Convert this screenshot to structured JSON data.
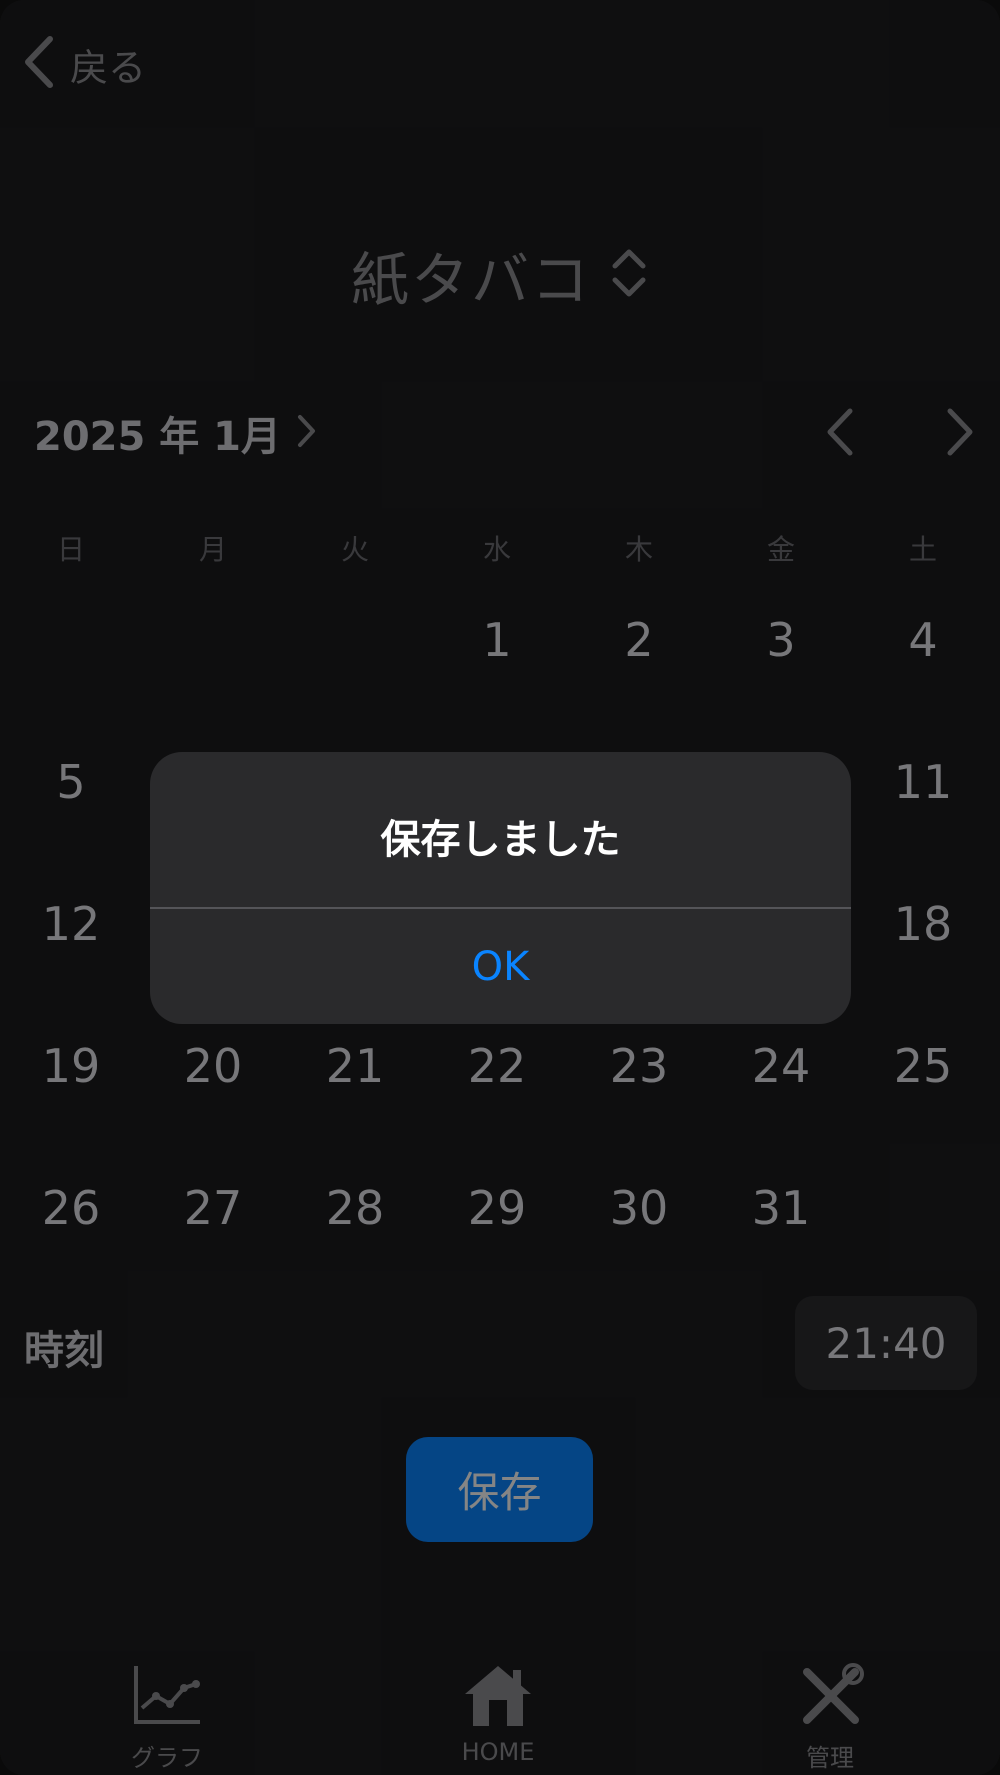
{
  "header": {
    "back_label": "戻る"
  },
  "category": {
    "label": "紙タバコ"
  },
  "calendar": {
    "month_label": "2025 年 1月",
    "weekdays": [
      "日",
      "月",
      "火",
      "水",
      "木",
      "金",
      "土"
    ],
    "days": [
      "1",
      "2",
      "3",
      "4",
      "5",
      "11",
      "12",
      "18",
      "19",
      "20",
      "21",
      "22",
      "23",
      "24",
      "25",
      "26",
      "27",
      "28",
      "29",
      "30",
      "31"
    ]
  },
  "time": {
    "label": "時刻",
    "value": "21:40"
  },
  "save_label": "保存",
  "tabs": [
    {
      "label": "グラフ",
      "icon": "chart-icon"
    },
    {
      "label": "HOME",
      "icon": "home-icon"
    },
    {
      "label": "管理",
      "icon": "tools-icon"
    }
  ],
  "alert": {
    "title": "保存しました",
    "ok_label": "OK"
  },
  "colors": {
    "accent": "#0a84ff",
    "background": "#1c1c1e",
    "alert_bg": "#2a2a2c"
  }
}
